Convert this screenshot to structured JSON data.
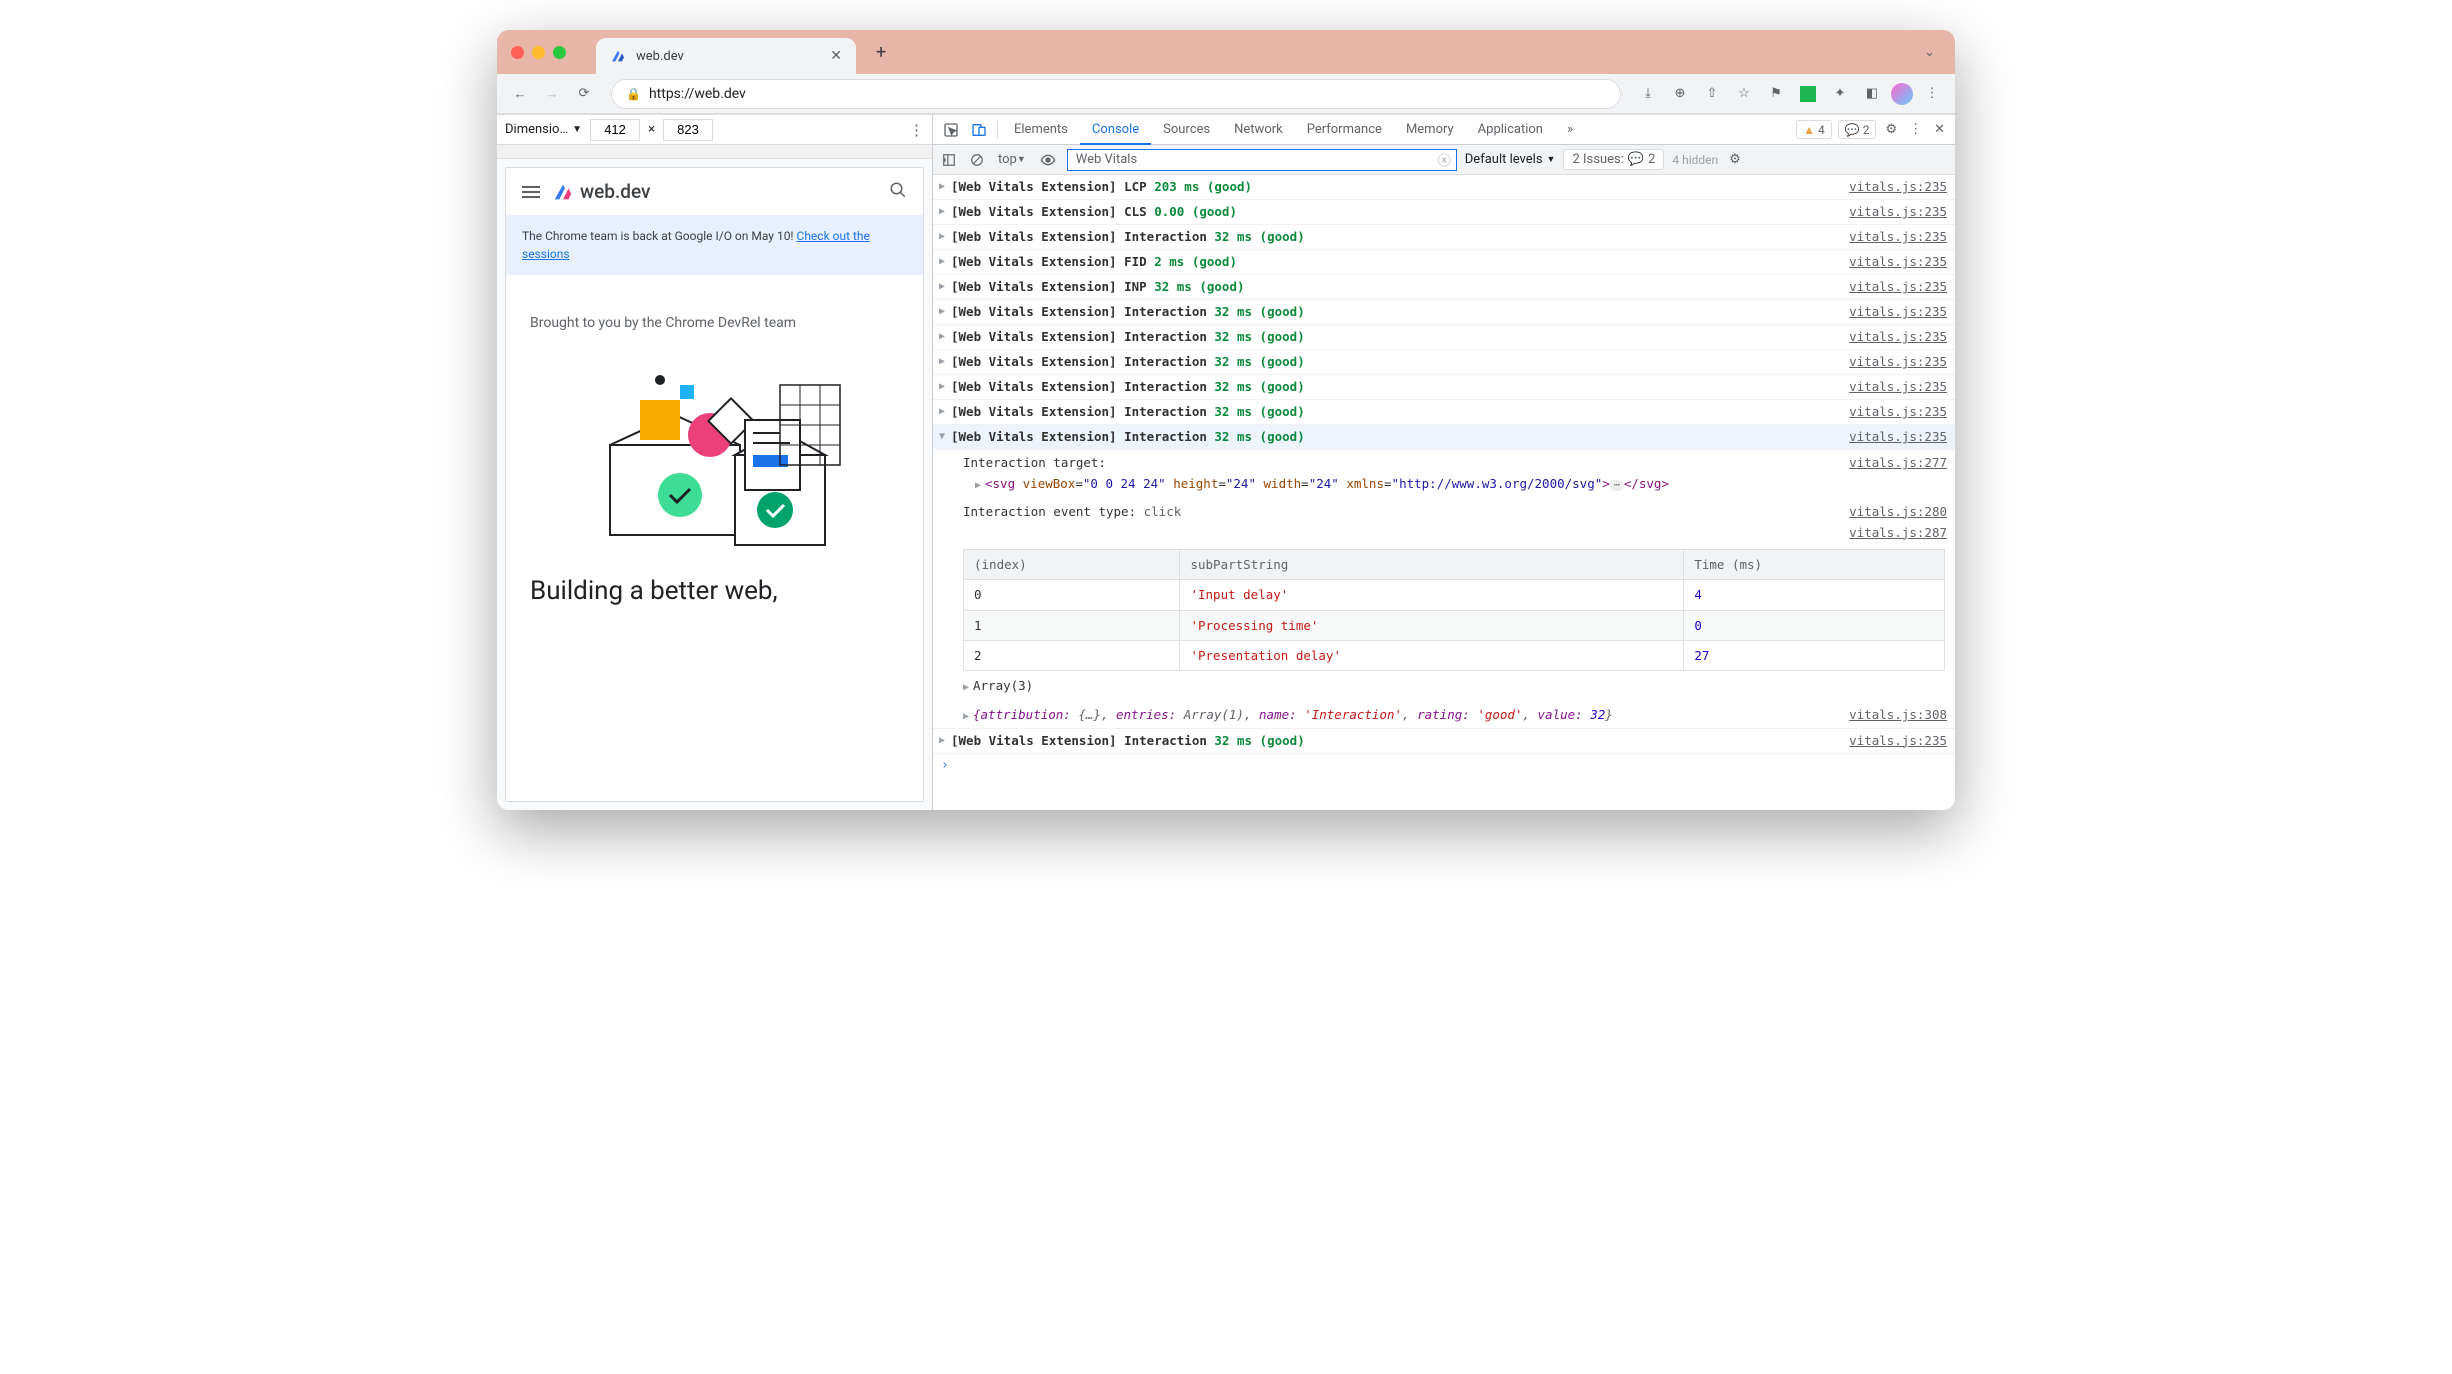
{
  "browser": {
    "tab_title": "web.dev",
    "url": "https://web.dev"
  },
  "device_toolbar": {
    "label": "Dimensio…",
    "width": "412",
    "height": "823",
    "times": "×"
  },
  "mobile_page": {
    "brand": "web.dev",
    "banner_text": "The Chrome team is back at Google I/O on May 10! ",
    "banner_link": "Check out the sessions",
    "subtitle": "Brought to you by the Chrome DevRel team",
    "headline": "Building a better web,"
  },
  "devtools": {
    "tabs": [
      "Elements",
      "Console",
      "Sources",
      "Network",
      "Performance",
      "Memory",
      "Application"
    ],
    "active_tab": "Console",
    "more": "»",
    "warn_count": "4",
    "msg_count": "2"
  },
  "console_toolbar": {
    "context": "top",
    "filter": "Web Vitals",
    "levels": "Default levels",
    "issues_label": "2 Issues:",
    "issues_count": "2",
    "hidden": "4 hidden"
  },
  "logs": [
    {
      "prefix": "[Web Vitals Extension] LCP",
      "val": "203 ms (good)",
      "src": "vitals.js:235"
    },
    {
      "prefix": "[Web Vitals Extension] CLS",
      "val": "0.00 (good)",
      "src": "vitals.js:235"
    },
    {
      "prefix": "[Web Vitals Extension] Interaction",
      "val": "32 ms (good)",
      "src": "vitals.js:235"
    },
    {
      "prefix": "[Web Vitals Extension] FID",
      "val": "2 ms (good)",
      "src": "vitals.js:235"
    },
    {
      "prefix": "[Web Vitals Extension] INP",
      "val": "32 ms (good)",
      "src": "vitals.js:235"
    },
    {
      "prefix": "[Web Vitals Extension] Interaction",
      "val": "32 ms (good)",
      "src": "vitals.js:235"
    },
    {
      "prefix": "[Web Vitals Extension] Interaction",
      "val": "32 ms (good)",
      "src": "vitals.js:235"
    },
    {
      "prefix": "[Web Vitals Extension] Interaction",
      "val": "32 ms (good)",
      "src": "vitals.js:235"
    },
    {
      "prefix": "[Web Vitals Extension] Interaction",
      "val": "32 ms (good)",
      "src": "vitals.js:235"
    },
    {
      "prefix": "[Web Vitals Extension] Interaction",
      "val": "32 ms (good)",
      "src": "vitals.js:235"
    }
  ],
  "expanded_log": {
    "prefix": "[Web Vitals Extension] Interaction",
    "val": "32 ms (good)",
    "src": "vitals.js:235",
    "target_label": "Interaction target:",
    "target_src": "vitals.js:277",
    "svg_viewbox": "0 0 24 24",
    "svg_height": "24",
    "svg_width": "24",
    "svg_xmlns": "http://www.w3.org/2000/svg",
    "event_type_label": "Interaction event type:",
    "event_type_value": "click",
    "event_type_src": "vitals.js:280",
    "table_src": "vitals.js:287",
    "table": {
      "headers": [
        "(index)",
        "subPartString",
        "Time (ms)"
      ],
      "rows": [
        {
          "idx": "0",
          "sub": "'Input delay'",
          "time": "4"
        },
        {
          "idx": "1",
          "sub": "'Processing time'",
          "time": "0"
        },
        {
          "idx": "2",
          "sub": "'Presentation delay'",
          "time": "27"
        }
      ],
      "array_label": "Array(3)"
    },
    "attribution_line": "{attribution: {…}, entries: Array(1), name: 'Interaction', rating: 'good', value: 32}",
    "attribution_src": "vitals.js:308"
  },
  "trailing_log": {
    "prefix": "[Web Vitals Extension] Interaction",
    "val": "32 ms (good)",
    "src": "vitals.js:235"
  }
}
